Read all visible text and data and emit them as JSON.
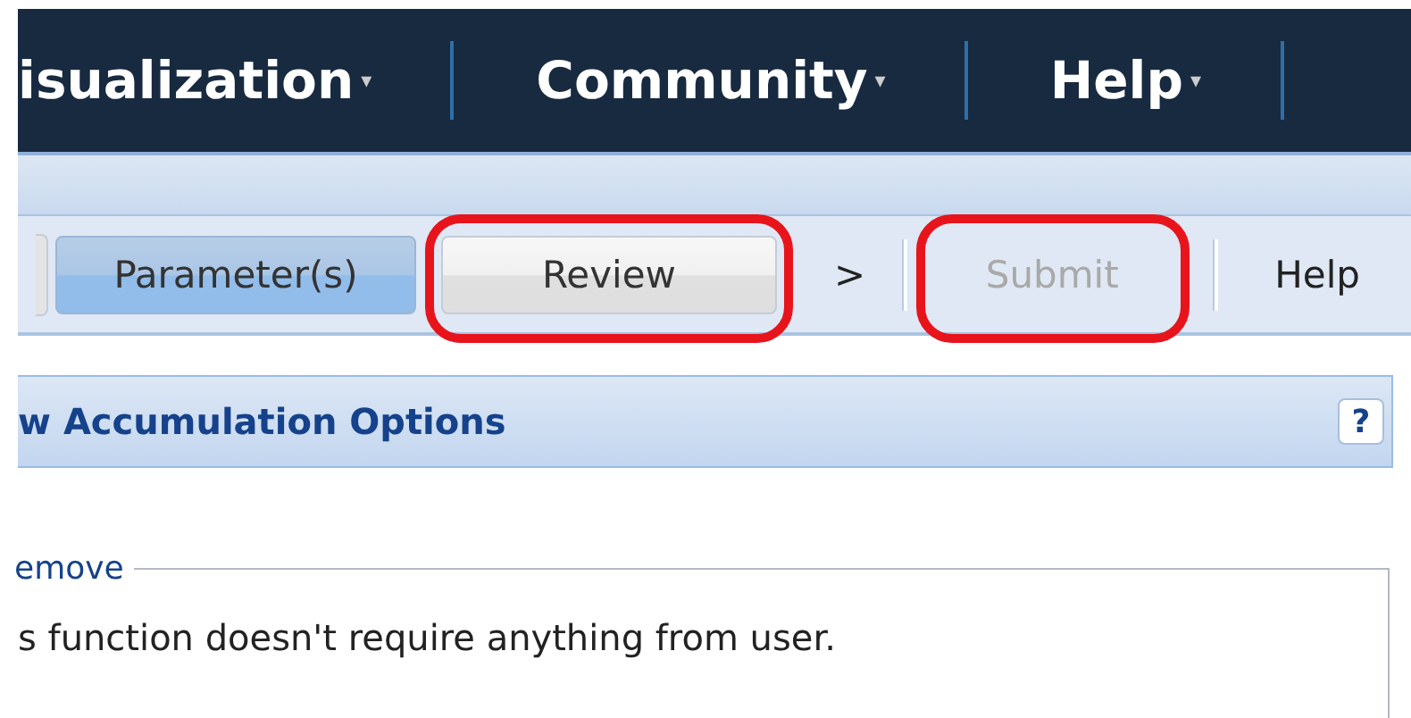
{
  "nav": {
    "items": [
      {
        "label": "isualization",
        "caret": "▾"
      },
      {
        "label": "Community",
        "caret": "▾"
      },
      {
        "label": "Help",
        "caret": "▾"
      }
    ]
  },
  "toolbar": {
    "items": [
      {
        "kind": "button",
        "label": "Parameter(s)",
        "selected": true,
        "disabled": false,
        "annotated": false
      },
      {
        "kind": "button",
        "label": "Review",
        "selected": false,
        "disabled": false,
        "annotated": true
      },
      {
        "kind": "link",
        "label": ">"
      },
      {
        "kind": "button",
        "label": "Submit",
        "selected": false,
        "disabled": true,
        "annotated": true
      },
      {
        "kind": "link",
        "label": "Help"
      }
    ]
  },
  "panel": {
    "title": "w Accumulation Options",
    "help": "?",
    "legend": "emove",
    "text": "s function doesn't require anything from user."
  }
}
